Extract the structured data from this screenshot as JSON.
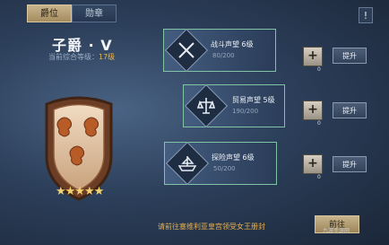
{
  "tabs": [
    {
      "label": "爵位"
    },
    {
      "label": "勋章"
    }
  ],
  "info_button": "!",
  "rank": {
    "title": "子爵 · V",
    "prefix": "当前综合等级：",
    "level": "17级",
    "stars": "★★★★★"
  },
  "reputations": [
    {
      "name": "战斗声望 6级",
      "value": "80/200",
      "icon": "crossed-swords-icon",
      "badge": "+",
      "count": "0",
      "button": "提升"
    },
    {
      "name": "贸易声望 5级",
      "value": "190/200",
      "icon": "scales-icon",
      "badge": "+",
      "count": "0",
      "button": "提升"
    },
    {
      "name": "探险声望 6级",
      "value": "50/200",
      "icon": "ship-icon",
      "badge": "+",
      "count": "0",
      "button": "提升"
    }
  ],
  "hint": "请前往塞维利亚皇宫领受女王册封",
  "go_button": "前往",
  "watermark": "九游手游网"
}
